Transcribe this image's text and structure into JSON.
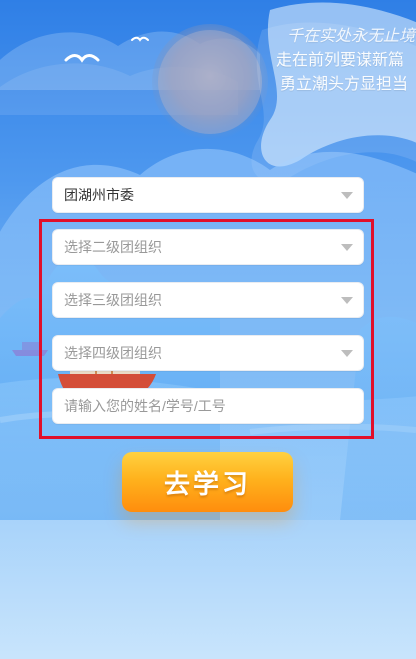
{
  "background": {
    "slogan_lines": [
      "千在实处永无止境",
      "走在前列要谋新篇",
      "勇立潮头方显担当"
    ]
  },
  "form": {
    "city_committee_value": "团湖州市委",
    "level2_placeholder": "选择二级团组织",
    "level3_placeholder": "选择三级团组织",
    "level4_placeholder": "选择四级团组织",
    "name_input_placeholder": "请输入您的姓名/学号/工号"
  },
  "actions": {
    "go_study_label": "去学习"
  },
  "colors": {
    "cta_gradient_top": "#ffd140",
    "cta_gradient_bottom": "#ff8d0d",
    "highlight_border": "#e10f2a",
    "background_top": "#2f7fe6",
    "background_bottom": "#c9e4fb"
  }
}
